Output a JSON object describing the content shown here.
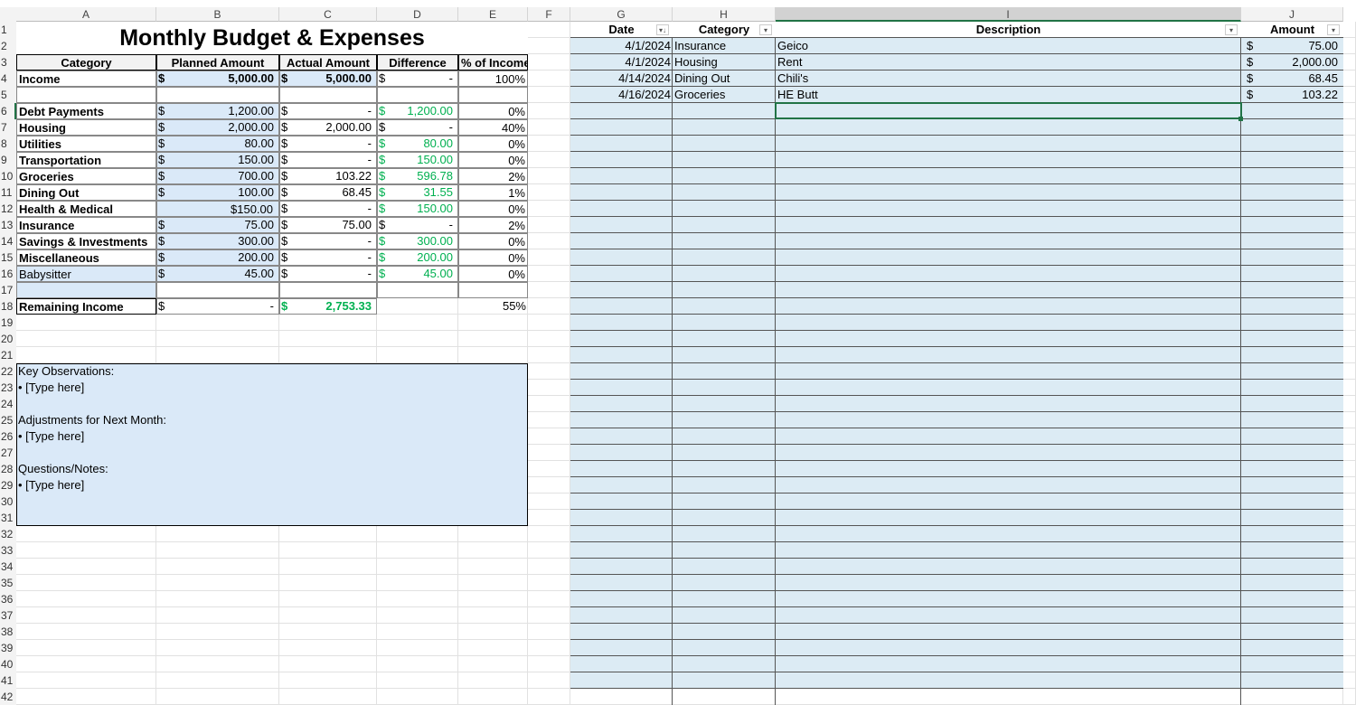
{
  "columns": [
    "A",
    "B",
    "C",
    "D",
    "E",
    "F",
    "G",
    "H",
    "I",
    "J"
  ],
  "title": "Monthly Budget & Expenses",
  "budget": {
    "headers": [
      "Category",
      "Planned Amount",
      "Actual Amount",
      "Difference",
      "% of Income"
    ],
    "income": {
      "category": "Income",
      "planned": "5,000.00",
      "actual": "5,000.00",
      "difference": "-",
      "percent": "100%"
    },
    "rows": [
      {
        "category": "Debt Payments",
        "planned": "1,200.00",
        "actual": "-",
        "difference": "1,200.00",
        "percent": "0%"
      },
      {
        "category": "Housing",
        "planned": "2,000.00",
        "actual": "2,000.00",
        "difference": "-",
        "percent": "40%"
      },
      {
        "category": "Utilities",
        "planned": "80.00",
        "actual": "-",
        "difference": "80.00",
        "percent": "0%"
      },
      {
        "category": "Transportation",
        "planned": "150.00",
        "actual": "-",
        "difference": "150.00",
        "percent": "0%"
      },
      {
        "category": "Groceries",
        "planned": "700.00",
        "actual": "103.22",
        "difference": "596.78",
        "percent": "2%"
      },
      {
        "category": "Dining Out",
        "planned": "100.00",
        "actual": "68.45",
        "difference": "31.55",
        "percent": "1%"
      },
      {
        "category": "Health & Medical",
        "planned": "$150.00",
        "actual": "-",
        "difference": "150.00",
        "percent": "0%",
        "planned_nosign": true
      },
      {
        "category": "Insurance",
        "planned": "75.00",
        "actual": "75.00",
        "difference": "-",
        "percent": "2%"
      },
      {
        "category": "Savings & Investments",
        "planned": "300.00",
        "actual": "-",
        "difference": "300.00",
        "percent": "0%"
      },
      {
        "category": "Miscellaneous",
        "planned": "200.00",
        "actual": "-",
        "difference": "200.00",
        "percent": "0%"
      },
      {
        "category": "Babysitter",
        "planned": "45.00",
        "actual": "-",
        "difference": "45.00",
        "percent": "0%",
        "normal": true
      }
    ],
    "remaining": {
      "label": "Remaining Income",
      "planned": "-",
      "actual": "2,753.33",
      "percent": "55%"
    },
    "currency": "$"
  },
  "notes": [
    "Key Observations:",
    "• [Type here]",
    "",
    "Adjustments for Next Month:",
    "• [Type here]",
    "",
    "Questions/Notes:",
    "• [Type here]"
  ],
  "expenses": {
    "headers": [
      "Date",
      "Category",
      "Description",
      "Amount"
    ],
    "rows": [
      {
        "date": "4/1/2024",
        "category": "Insurance",
        "description": "Geico",
        "amount": "75.00"
      },
      {
        "date": "4/1/2024",
        "category": "Housing",
        "description": "Rent",
        "amount": "2,000.00"
      },
      {
        "date": "4/14/2024",
        "category": "Dining Out",
        "description": "Chili's",
        "amount": "68.45"
      },
      {
        "date": "4/16/2024",
        "category": "Groceries",
        "description": "HE Butt",
        "amount": "103.22"
      }
    ]
  },
  "row_numbers": [
    "1",
    "2",
    "3",
    "4",
    "5",
    "6",
    "7",
    "8",
    "9",
    "10",
    "11",
    "12",
    "13",
    "14",
    "15",
    "16",
    "17",
    "18",
    "19",
    "20",
    "21",
    "22",
    "23",
    "24",
    "25",
    "26",
    "27",
    "28",
    "29",
    "30",
    "31",
    "32",
    "33",
    "34",
    "35",
    "36",
    "37",
    "38",
    "39",
    "40",
    "41",
    "42"
  ]
}
